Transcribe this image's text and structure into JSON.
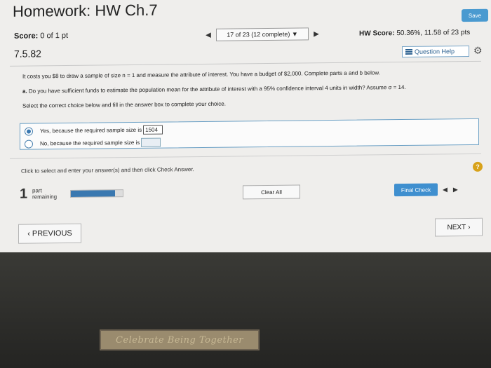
{
  "header": {
    "title": "Homework: HW Ch.7",
    "save_label": "Save"
  },
  "score": {
    "label": "Score:",
    "value": "0 of 1 pt"
  },
  "nav": {
    "prev_icon": "◀",
    "status": "17 of 23 (12 complete) ▼",
    "next_icon": "▶"
  },
  "hw_score": {
    "label": "HW Score:",
    "value": "50.36%, 11.58 of 23 pts"
  },
  "question": {
    "number": "7.5.82",
    "help_label": "Question Help",
    "help_icon": "list-icon",
    "settings_icon": "gear-icon",
    "intro": "It costs you $8 to draw a sample of size n = 1 and measure the attribute of interest. You have a budget of $2,000. Complete parts a and b below.",
    "part_a_prefix": "a.",
    "part_a_text": "Do you have sufficient funds to estimate the population mean for the attribute of interest with a 95% confidence interval 4 units in width? Assume σ = 14.",
    "instruction": "Select the correct choice below and fill in the answer box to complete your choice.",
    "choices": [
      {
        "text": "Yes, because the required sample size is",
        "answer": "1504",
        "selected": true
      },
      {
        "text": "No, because the required sample size is",
        "answer": "",
        "selected": false
      }
    ]
  },
  "footer": {
    "instruction": "Click to select and enter your answer(s) and then click Check Answer.",
    "help_label": "?",
    "parts_count": "1",
    "parts_label_top": "part",
    "parts_label_bottom": "remaining",
    "progress_fraction": 0.85,
    "clear_all_label": "Clear All",
    "final_check_label": "Final Check",
    "part_prev_icon": "◀",
    "part_next_icon": "▶",
    "previous_label": "PREVIOUS",
    "next_label": "NEXT"
  },
  "sticker": {
    "text": "Celebrate Being Together"
  }
}
